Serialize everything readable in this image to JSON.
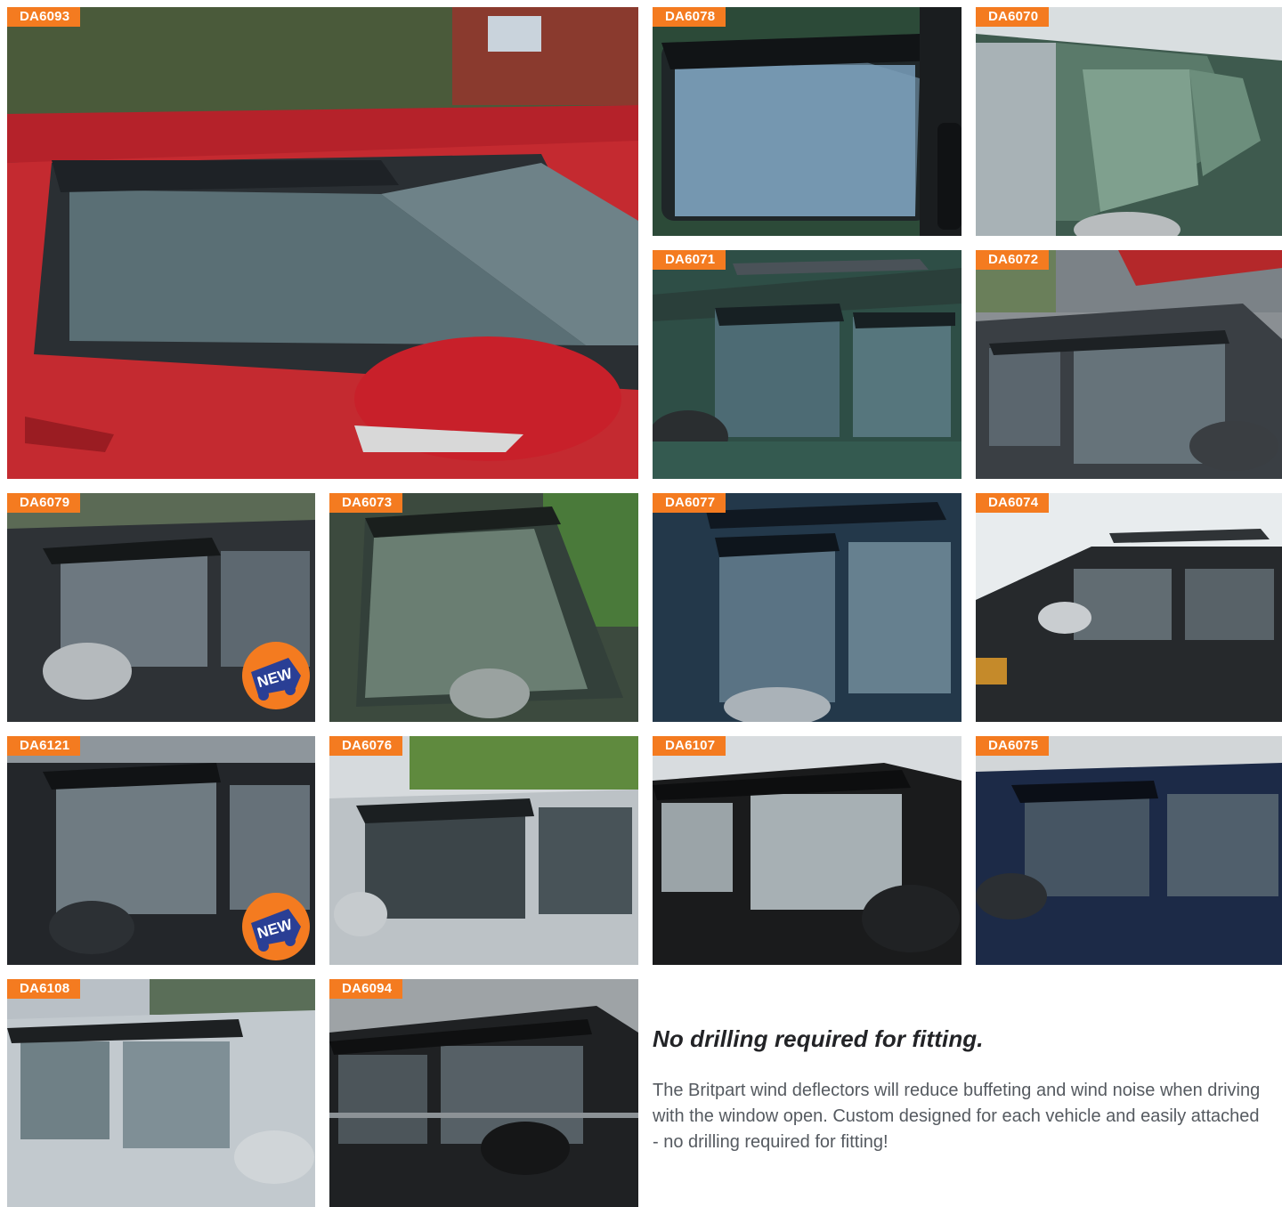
{
  "tiles": [
    {
      "code": "DA6093",
      "scene": "red",
      "badge": ""
    },
    {
      "code": "DA6078",
      "scene": "green-door",
      "badge": ""
    },
    {
      "code": "DA6070",
      "scene": "green-roof",
      "badge": ""
    },
    {
      "code": "DA6071",
      "scene": "green-side",
      "badge": ""
    },
    {
      "code": "DA6072",
      "scene": "grey-side",
      "badge": ""
    },
    {
      "code": "DA6079",
      "scene": "dark-grey",
      "badge": "NEW"
    },
    {
      "code": "DA6073",
      "scene": "green-door",
      "badge": ""
    },
    {
      "code": "DA6077",
      "scene": "blue-side",
      "badge": ""
    },
    {
      "code": "DA6074",
      "scene": "black-side",
      "badge": ""
    },
    {
      "code": "DA6121",
      "scene": "black-side",
      "badge": "NEW"
    },
    {
      "code": "DA6076",
      "scene": "silver-side",
      "badge": ""
    },
    {
      "code": "DA6107",
      "scene": "black-interior",
      "badge": ""
    },
    {
      "code": "DA6075",
      "scene": "navy-side",
      "badge": ""
    },
    {
      "code": "DA6108",
      "scene": "silver-side",
      "badge": ""
    },
    {
      "code": "DA6094",
      "scene": "black-side",
      "badge": ""
    }
  ],
  "info": {
    "heading": "No drilling required for fitting.",
    "body": "The Britpart wind deflectors will reduce buffeting and wind noise when driving with the window open. Custom designed for each vehicle and easily attached - no drilling required for fitting!"
  },
  "colors": {
    "accent": "#f47b20",
    "badge_text": "#2a3f95",
    "heading": "#222326",
    "body": "#555a60"
  }
}
